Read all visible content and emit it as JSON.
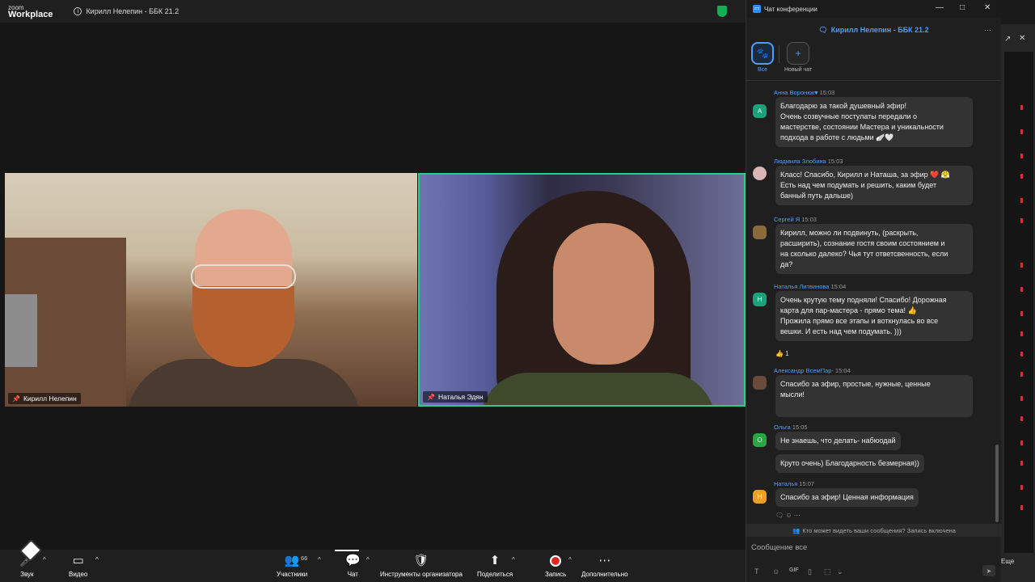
{
  "app": {
    "logo_line1": "zoom",
    "logo_line2": "Workplace",
    "meeting_title": "Кирилл Нелепин - ББК 21.2"
  },
  "participants": [
    {
      "name": "Кирилл Нелепин"
    },
    {
      "name": "Наталья Эдян"
    }
  ],
  "toolbar": {
    "audio": "Звук",
    "video": "Видео",
    "participants": "Участники",
    "participants_count": "66",
    "chat": "Чат",
    "host_tools": "Инструменты организатора",
    "share": "Поделиться",
    "record": "Запись",
    "more": "Дополнительно"
  },
  "chat": {
    "window_title": "Чат конференции",
    "header": "Кирилл Нелепин - ББК 21.2",
    "channels": [
      {
        "label": "Все"
      },
      {
        "label": "Новый чат"
      }
    ],
    "messages": [
      {
        "sender": "Анна Воронюк",
        "time": "15:03",
        "avatar": "А",
        "avatar_color": "#1aa37a",
        "lines": [
          "Благодарю за такой душевный эфир!",
          "Очень созвучные постулаты передали о",
          "мастерстве, состоянии Мастера и уникальности",
          "подхода в работе с людьми 🪽🤍"
        ]
      },
      {
        "sender": "Людмила Злобина",
        "time": "15:03",
        "avatar": "",
        "avatar_color": "#caa",
        "lines": [
          "Класс! Спасибо, Кирилл и Наташа, за эфир ❤️ 😤",
          "Есть над чем подумать и решить, каким будет",
          "банный путь дальше)"
        ]
      },
      {
        "sender": "Сергей Я",
        "time": "15:03",
        "avatar": "",
        "avatar_color": "#8a6a3a",
        "lines": [
          "Кирилл, можно ли подвинуть, (раскрыть,",
          "расширить),  сознание гостя своим состоянием и",
          "на сколько далеко? Чья тут ответсвенность, если",
          "да?"
        ]
      },
      {
        "sender": "Наталья Литвинова",
        "time": "15:04",
        "avatar": "Н",
        "avatar_color": "#1aa37a",
        "lines": [
          "Очень крутую тему подняли! Спасибо! Дорожная",
          "карта для пар-мастера - прямо тема! 👍",
          "Прожила прямо все этапы и воткнулась во все",
          "вешки. И есть над чем подумать. )))"
        ],
        "reaction": "👍 1"
      },
      {
        "sender": "Александр ВсемПар-",
        "time": "15:04",
        "avatar": "",
        "avatar_color": "#6a4a3a",
        "lines": [
          "Спасибо за эфир, простые, нужные, ценные",
          "мысли!"
        ]
      },
      {
        "sender": "Ольга",
        "time": "15:05",
        "avatar": "О",
        "avatar_color": "#27a844",
        "lines": [
          "Не знаешь, что делать- набюодай"
        ],
        "extra": "Круто очень) Благодарность безмерная))"
      },
      {
        "sender": "Наталья",
        "time": "15:07",
        "avatar": "Н",
        "avatar_color": "#f0a020",
        "lines": [
          "Спасибо за эфир! Ценная информация"
        ]
      }
    ],
    "privacy_note": "Кто может видеть ваши сообщения? Запись включена",
    "input_placeholder": "Сообщение все"
  },
  "background_window": {
    "more_label": "Еще"
  }
}
